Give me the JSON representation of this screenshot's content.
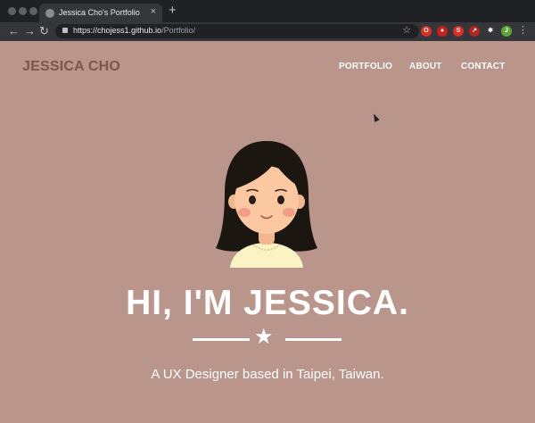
{
  "browser": {
    "tab_title": "Jessica Cho's Portfolio",
    "tab_close": "×",
    "new_tab": "+",
    "url_host": "https://chojess1.github.io",
    "url_path": "/Portfolio/",
    "back": "←",
    "forward": "→",
    "reload": "↻",
    "bookmark": "☆",
    "menu": "⋮",
    "extensions": [
      {
        "name": "ext-red-circle-icon",
        "color": "#d93025",
        "glyph": "O"
      },
      {
        "name": "ext-red-shield-icon",
        "color": "#c5221f",
        "glyph": "●"
      },
      {
        "name": "ext-red-s-icon",
        "color": "#d93025",
        "glyph": "S"
      },
      {
        "name": "ext-red-arrow-icon",
        "color": "#b3261e",
        "glyph": "↗"
      },
      {
        "name": "extensions-puzzle-icon",
        "color": "#35363a",
        "glyph": "✱"
      },
      {
        "name": "profile-avatar-icon",
        "color": "#5fa43a",
        "glyph": "J"
      }
    ]
  },
  "site": {
    "brand": "JESSICA CHO",
    "nav": [
      "PORTFOLIO",
      "ABOUT",
      "CONTACT"
    ],
    "hero_title": "HI, I'M JESSICA.",
    "divider_icon": "★",
    "tagline": "A UX Designer based in Taipei, Taiwan."
  },
  "colors": {
    "page_bg": "#b9958c",
    "brand": "#7e5649",
    "text": "#ffffff"
  }
}
